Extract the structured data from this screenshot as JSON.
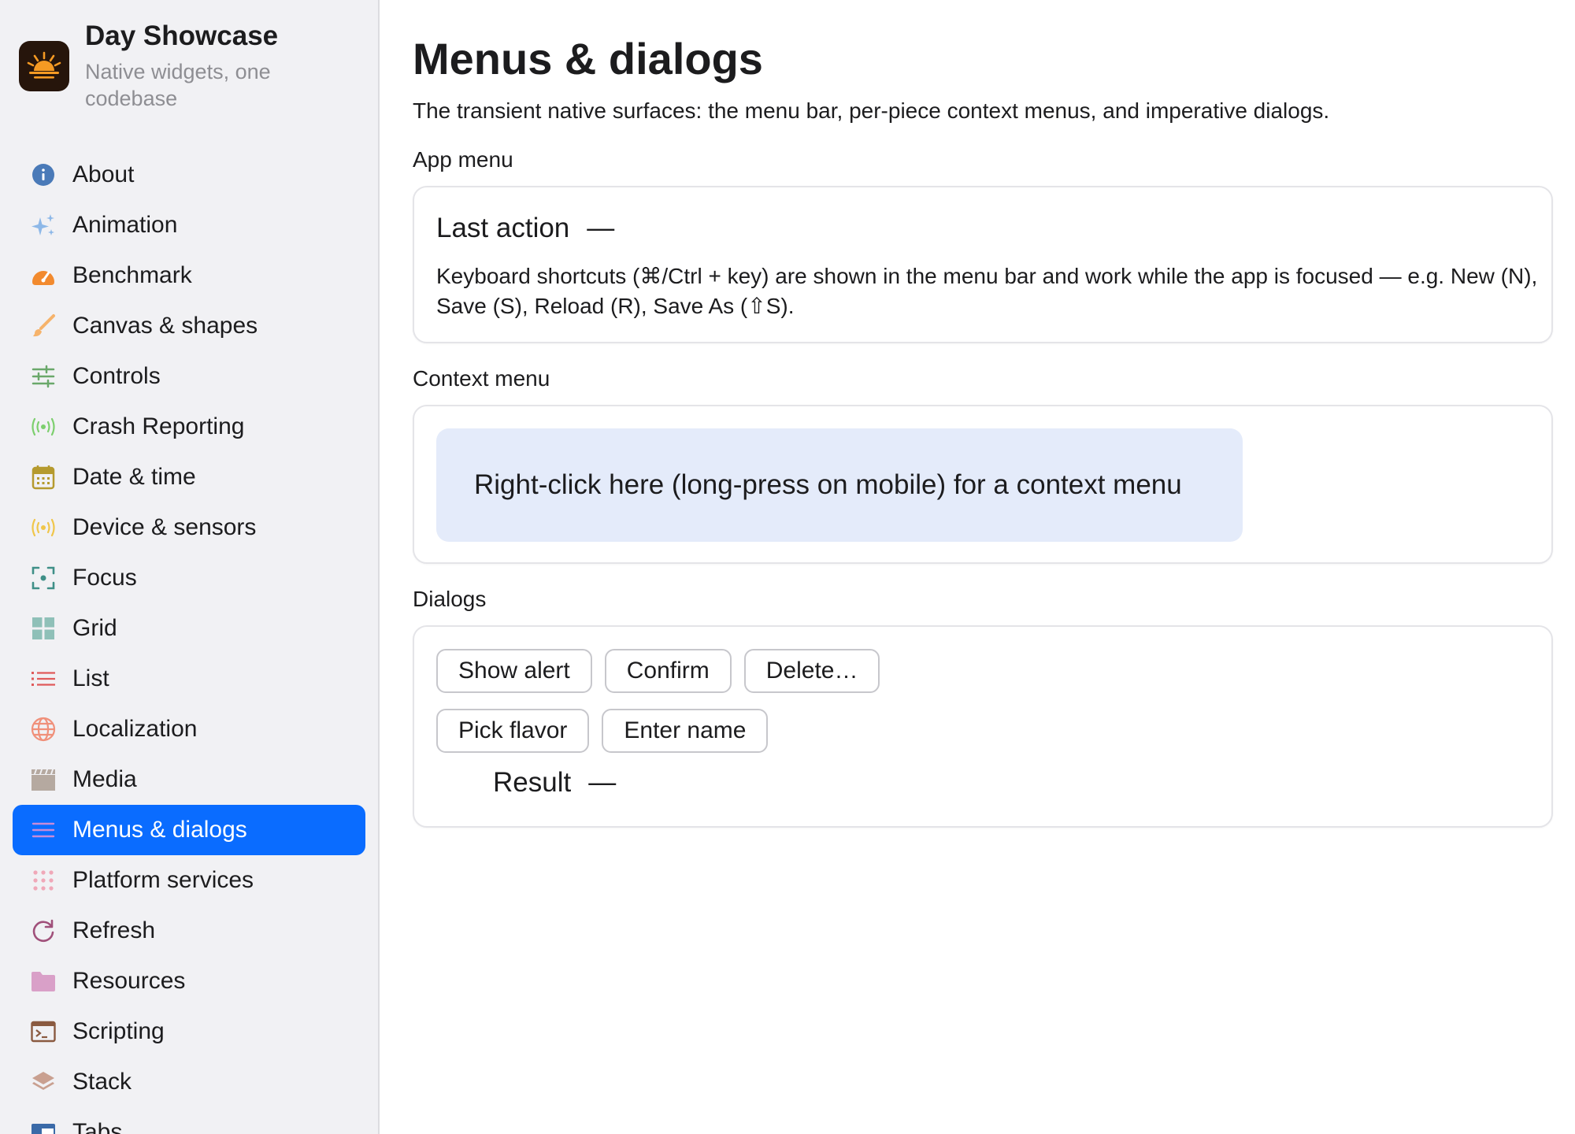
{
  "app": {
    "title": "Day Showcase",
    "subtitle": "Native widgets, one codebase",
    "icon": "sunrise-icon"
  },
  "sidebar": {
    "active_index": 13,
    "items": [
      {
        "label": "About",
        "icon": "info-icon",
        "color": "#4a7ab8"
      },
      {
        "label": "Animation",
        "icon": "sparkles-icon",
        "color": "#8db8e8"
      },
      {
        "label": "Benchmark",
        "icon": "speedometer-icon",
        "color": "#f28a2e"
      },
      {
        "label": "Canvas & shapes",
        "icon": "brush-icon",
        "color": "#f6b36b"
      },
      {
        "label": "Controls",
        "icon": "sliders-icon",
        "color": "#6aa86a"
      },
      {
        "label": "Crash Reporting",
        "icon": "broadcast-icon",
        "color": "#7dcf6e"
      },
      {
        "label": "Date & time",
        "icon": "calendar-icon",
        "color": "#b59a2e"
      },
      {
        "label": "Device & sensors",
        "icon": "sensor-icon",
        "color": "#f0c64a"
      },
      {
        "label": "Focus",
        "icon": "focus-icon",
        "color": "#3f8f87"
      },
      {
        "label": "Grid",
        "icon": "grid-icon",
        "color": "#8fc0b8"
      },
      {
        "label": "List",
        "icon": "list-icon",
        "color": "#e05a5a"
      },
      {
        "label": "Localization",
        "icon": "globe-icon",
        "color": "#f0907a"
      },
      {
        "label": "Media",
        "icon": "clapperboard-icon",
        "color": "#b5a9a0"
      },
      {
        "label": "Menus & dialogs",
        "icon": "menu-icon",
        "color": "#c78bd8"
      },
      {
        "label": "Platform services",
        "icon": "dots-grid-icon",
        "color": "#f0a8b8"
      },
      {
        "label": "Refresh",
        "icon": "refresh-icon",
        "color": "#a0507a"
      },
      {
        "label": "Resources",
        "icon": "folder-icon",
        "color": "#d9a0c8"
      },
      {
        "label": "Scripting",
        "icon": "terminal-icon",
        "color": "#8a5a40"
      },
      {
        "label": "Stack",
        "icon": "stack-icon",
        "color": "#c9a090"
      },
      {
        "label": "Tabs",
        "icon": "tabs-icon",
        "color": "#3a6aa8"
      }
    ]
  },
  "main": {
    "title": "Menus & dialogs",
    "description": "The transient native surfaces: the menu bar, per-piece context menus, and imperative dialogs.",
    "app_menu": {
      "section_label": "App menu",
      "last_action_label": "Last action",
      "last_action_value": "—",
      "shortcut_text": "Keyboard shortcuts (⌘/Ctrl + key) are shown in the menu bar and work while the app is focused — e.g. New (N), Save (S), Reload (R), Save As (⇧S)."
    },
    "context_menu": {
      "section_label": "Context menu",
      "target_text": "Right-click here (long-press on mobile) for a context menu"
    },
    "dialogs": {
      "section_label": "Dialogs",
      "buttons_row1": [
        "Show alert",
        "Confirm",
        "Delete…"
      ],
      "buttons_row2": [
        "Pick flavor",
        "Enter name"
      ],
      "result_label": "Result",
      "result_value": "—"
    }
  },
  "colors": {
    "accent": "#0a6cff",
    "context_target_bg": "#e4ebfa",
    "sidebar_bg": "#f1f1f4"
  }
}
